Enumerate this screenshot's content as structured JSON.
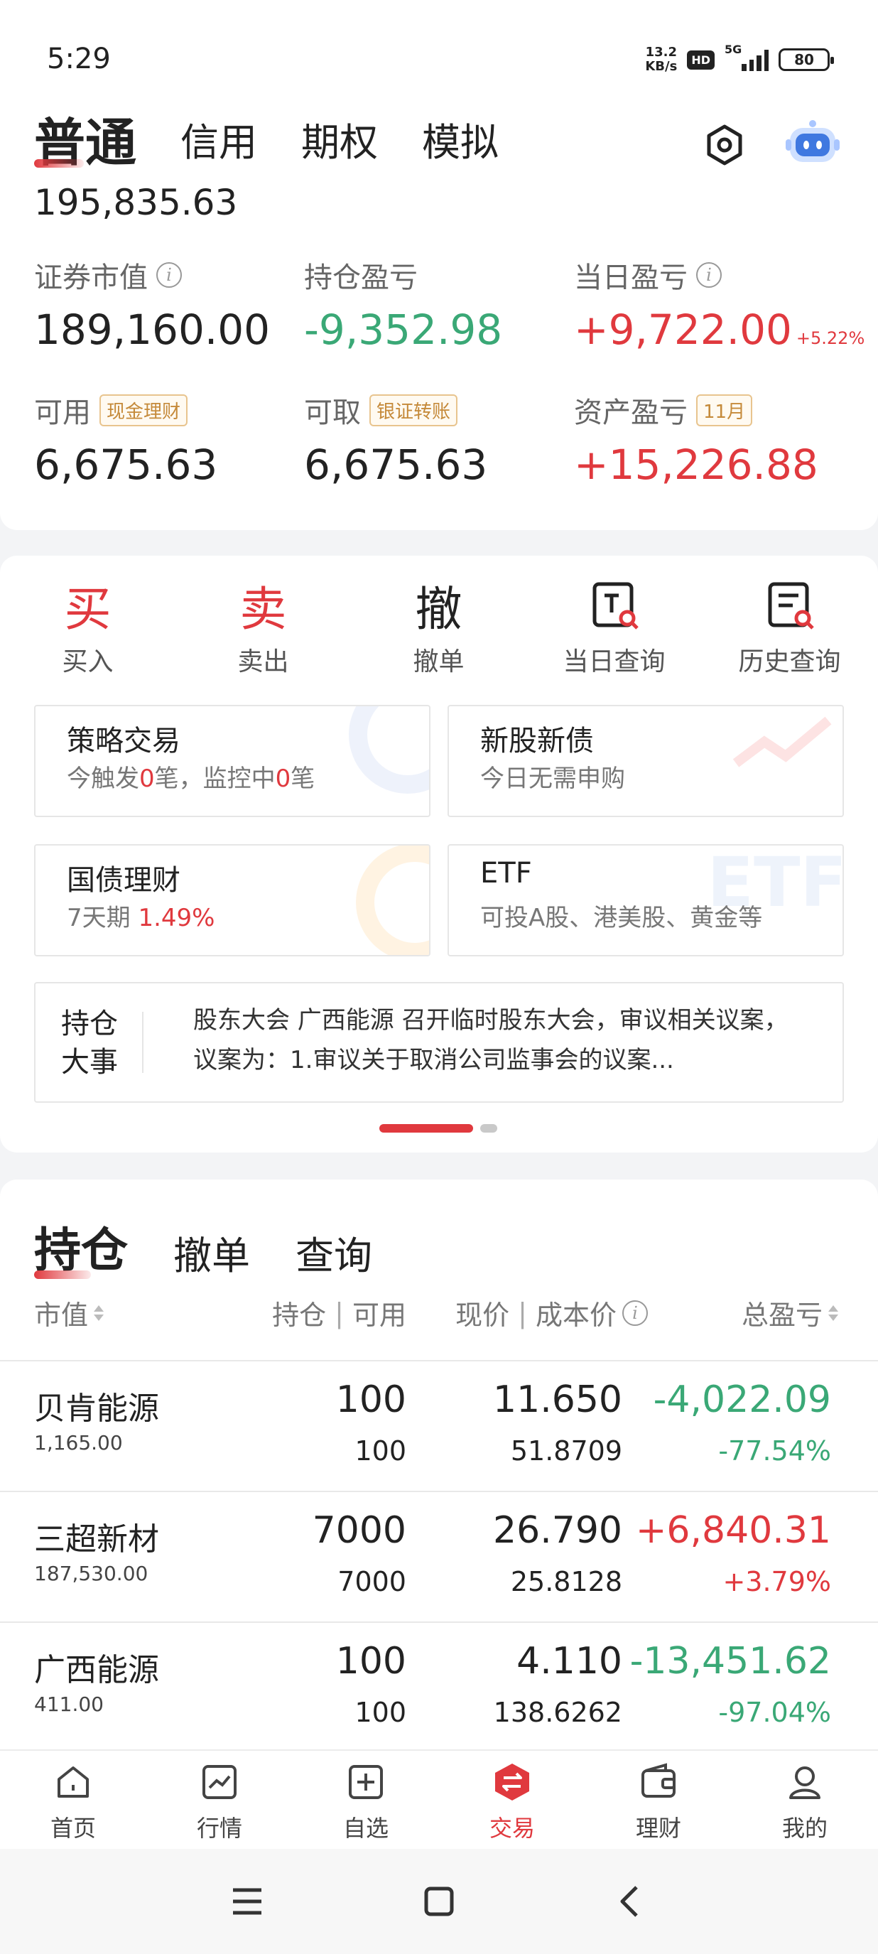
{
  "status": {
    "time": "5:29",
    "net_speed_value": "13.2",
    "net_speed_unit": "KB/s",
    "hd": "HD",
    "network": "5G",
    "battery": "80"
  },
  "account_tabs": [
    "普通",
    "信用",
    "期权",
    "模拟"
  ],
  "total_asset": "195,835.63",
  "stats": {
    "market_value_label": "证券市值",
    "market_value": "189,160.00",
    "position_pl_label": "持仓盈亏",
    "position_pl": "-9,352.98",
    "daily_pl_label": "当日盈亏",
    "daily_pl": "+9,722.00",
    "daily_pl_pct": "+5.22%",
    "available_label": "可用",
    "available_tag": "现金理财",
    "available": "6,675.63",
    "withdrawable_label": "可取",
    "withdrawable_tag": "银证转账",
    "withdrawable": "6,675.63",
    "asset_pl_label": "资产盈亏",
    "asset_pl_tag": "11月",
    "asset_pl": "+15,226.88"
  },
  "quick_actions": [
    {
      "glyph": "买",
      "label": "买入"
    },
    {
      "glyph": "卖",
      "label": "卖出"
    },
    {
      "glyph": "撤",
      "label": "撤单"
    },
    {
      "glyph": "",
      "label": "当日查询"
    },
    {
      "glyph": "",
      "label": "历史查询"
    }
  ],
  "feature_boxes": {
    "strategy_title": "策略交易",
    "strategy_sub_a": "今触发",
    "strategy_count_a": "0",
    "strategy_sub_b": "笔，监控中",
    "strategy_count_b": "0",
    "strategy_sub_c": "笔",
    "ipo_title": "新股新债",
    "ipo_sub": "今日无需申购",
    "bond_title": "国债理财",
    "bond_term": "7天期",
    "bond_rate": "1.49%",
    "etf_title": "ETF",
    "etf_sub": "可投A股、港美股、黄金等",
    "etf_bg_text": "ETF"
  },
  "news": {
    "label": "持仓大事",
    "text": "股东大会 广西能源 召开临时股东大会，审议相关议案，议案为：1.审议关于取消公司监事会的议案..."
  },
  "holdings_tabs": [
    "持仓",
    "撤单",
    "查询"
  ],
  "columns": {
    "market_value": "市值",
    "position": "持仓",
    "available": "可用",
    "price": "现价",
    "cost": "成本价",
    "total_pl": "总盈亏"
  },
  "holdings": [
    {
      "name": "贝肯能源",
      "market_value": "1,165.00",
      "qty": "100",
      "available": "100",
      "price": "11.650",
      "cost": "51.8709",
      "pl": "-4,022.09",
      "pl_pct": "-77.54%"
    },
    {
      "name": "三超新材",
      "market_value": "187,530.00",
      "qty": "7000",
      "available": "7000",
      "price": "26.790",
      "cost": "25.8128",
      "pl": "+6,840.31",
      "pl_pct": "+3.79%"
    },
    {
      "name": "广西能源",
      "market_value": "411.00",
      "qty": "100",
      "available": "100",
      "price": "4.110",
      "cost": "138.6262",
      "pl": "-13,451.62",
      "pl_pct": "-97.04%"
    }
  ],
  "nav": [
    "首页",
    "行情",
    "自选",
    "交易",
    "理财",
    "我的"
  ],
  "colors": {
    "accent": "#e0393e",
    "gain": "#e0393e",
    "loss": "#3aa876"
  }
}
